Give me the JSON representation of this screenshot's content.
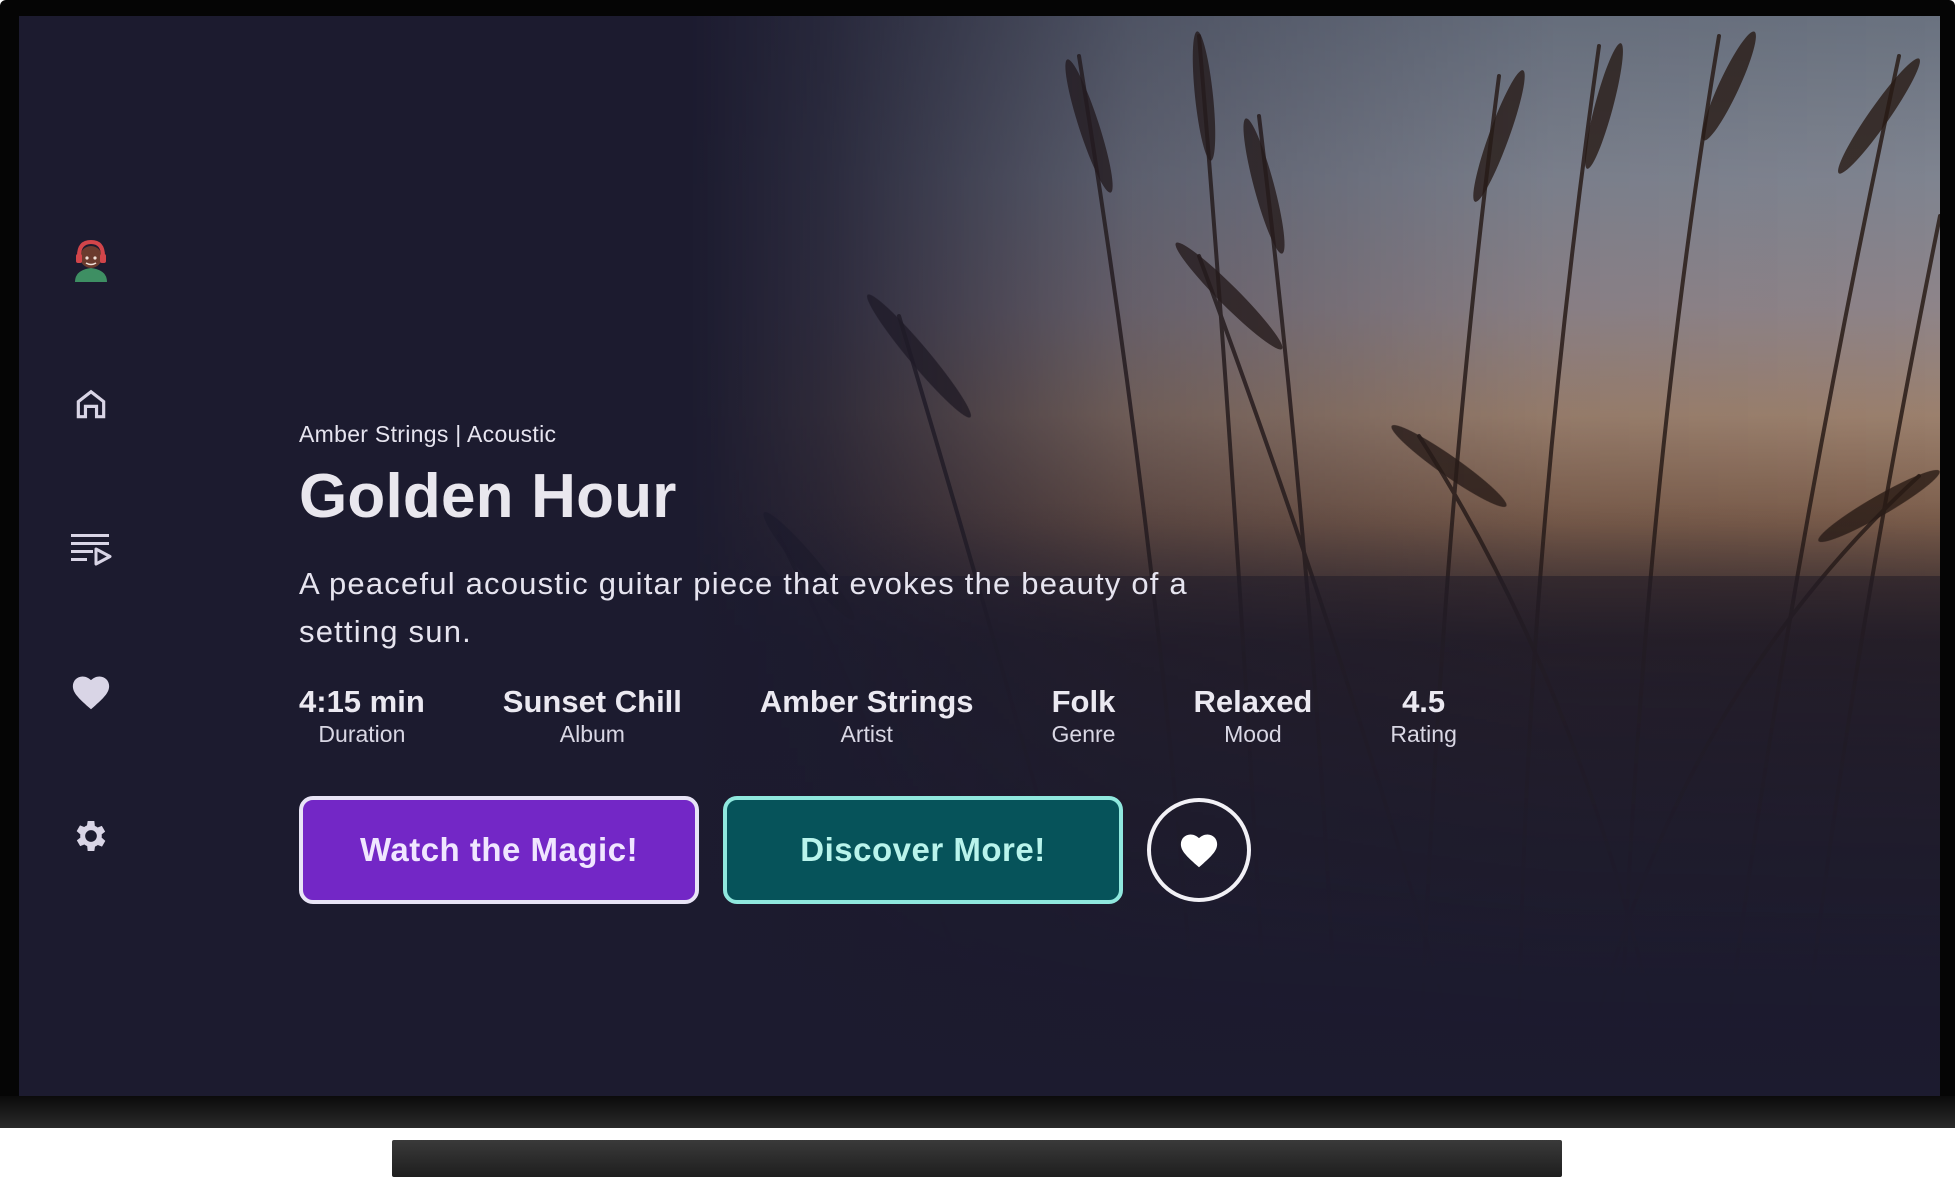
{
  "nav": {
    "items": [
      {
        "icon": "avatar-icon"
      },
      {
        "icon": "home-icon"
      },
      {
        "icon": "playlist-icon"
      },
      {
        "icon": "heart-icon"
      },
      {
        "icon": "gear-icon"
      }
    ]
  },
  "track": {
    "subtitle": "Amber Strings | Acoustic",
    "title": "Golden Hour",
    "description": "A peaceful acoustic guitar piece that evokes the beauty of a setting sun."
  },
  "stats": [
    {
      "value": "4:15 min",
      "label": "Duration"
    },
    {
      "value": "Sunset Chill",
      "label": "Album"
    },
    {
      "value": "Amber Strings",
      "label": "Artist"
    },
    {
      "value": "Folk",
      "label": "Genre"
    },
    {
      "value": "Relaxed",
      "label": "Mood"
    },
    {
      "value": "4.5",
      "label": "Rating"
    }
  ],
  "actions": {
    "primary_label": "Watch the Magic!",
    "secondary_label": "Discover More!",
    "favorite_icon": "heart-icon"
  },
  "colors": {
    "background": "#1c1b2f",
    "primary_button": "#7327c6",
    "secondary_button": "#06535a",
    "secondary_border": "#8fe8de",
    "nav_icon": "#d9d5e6"
  }
}
